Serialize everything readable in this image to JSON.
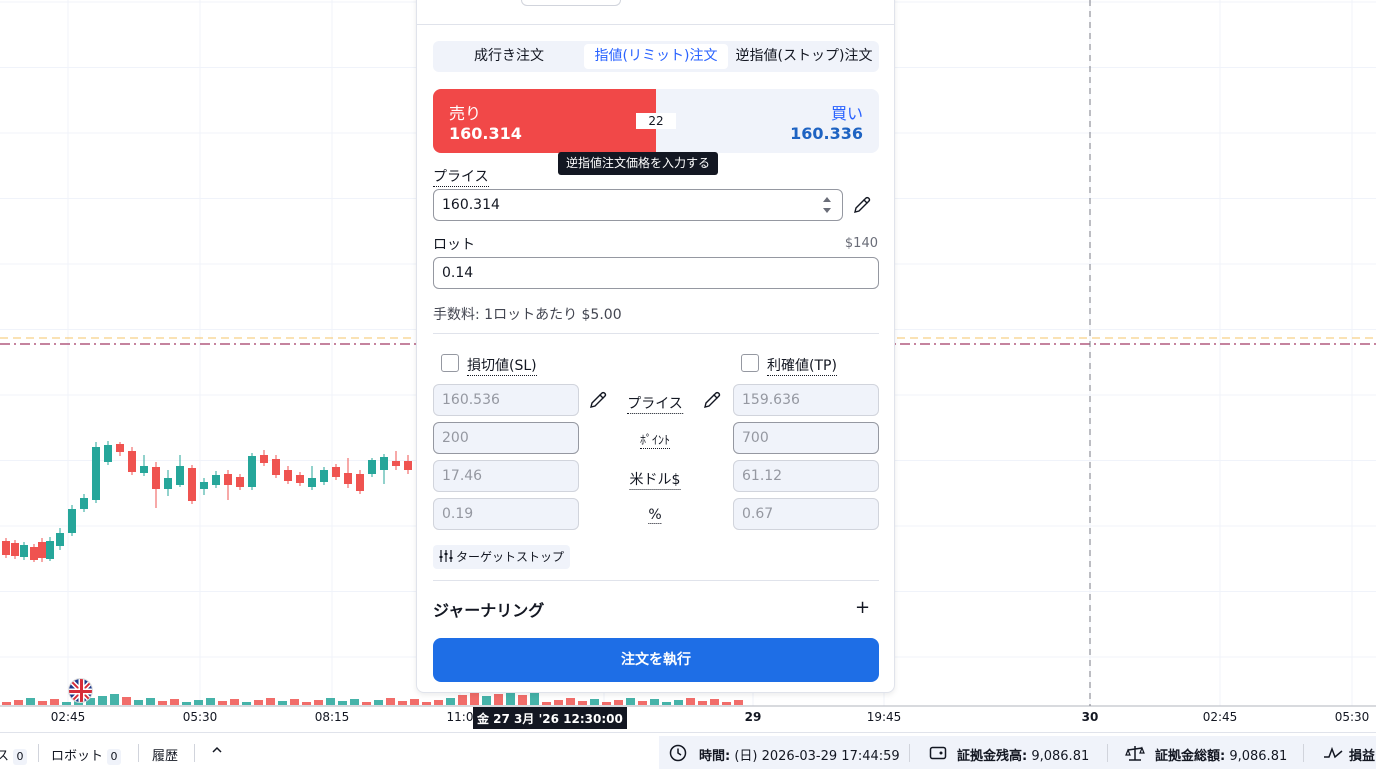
{
  "colors": {
    "up_candle": "#26a69a",
    "down_candle": "#ef5350",
    "sell_bg": "#f14848",
    "buy_text": "#2962ff",
    "primary_button": "#1e6ee6",
    "grid": "#f0f3fa"
  },
  "chart": {
    "time_axis": [
      "02:45",
      "05:30",
      "08:15",
      "11:0",
      "29",
      "19:45",
      "30",
      "02:45",
      "05:30"
    ],
    "time_axis_partial": "45",
    "crosshair_time": "金 27 3月 '26 12:30:00",
    "event_flag_icon": "uk-flag-icon"
  },
  "bottom_bar": {
    "tab_1_label": "ス",
    "tab_1_count": "0",
    "robot_label": "ロボット",
    "robot_count": "0",
    "history_label": "履歴",
    "collapse_icon": "chevron-up-icon",
    "time_label": "時間:",
    "time_value": "(日) 2026-03-29 17:44:59",
    "balance_label": "証拠金残高:",
    "balance_value": "9,086.81",
    "equity_label": "証拠金総額:",
    "equity_value": "9,086.81",
    "pnl_label": "損益"
  },
  "order_panel": {
    "tabs": [
      "成行き注文",
      "指値(リミット)注文",
      "逆指値(ストップ)注文"
    ],
    "active_tab": "指値(リミット)注文",
    "sell_label": "売り",
    "sell_price": "160.314",
    "buy_label": "買い",
    "buy_price": "160.336",
    "spread": "22",
    "tooltip": "逆指値注文価格を入力する",
    "price_label": "プライス",
    "price_value": "160.314",
    "lot_label": "ロット",
    "lot_usd": "$140",
    "lot_value": "0.14",
    "fee_text": "手数料: 1ロットあたり $5.00",
    "sl_label": "損切値(SL)",
    "tp_label": "利確値(TP)",
    "row_labels": [
      "プライス",
      "ﾎﾟｲﾝﾄ",
      "米ドル$",
      "%"
    ],
    "sl_values": [
      "160.536",
      "200",
      "17.46",
      "0.19"
    ],
    "tp_values": [
      "159.636",
      "700",
      "61.12",
      "0.67"
    ],
    "trailing_stop_label": "ターゲットストップ",
    "journal_label": "ジャーナリング",
    "execute_label": "注文を執行"
  }
}
